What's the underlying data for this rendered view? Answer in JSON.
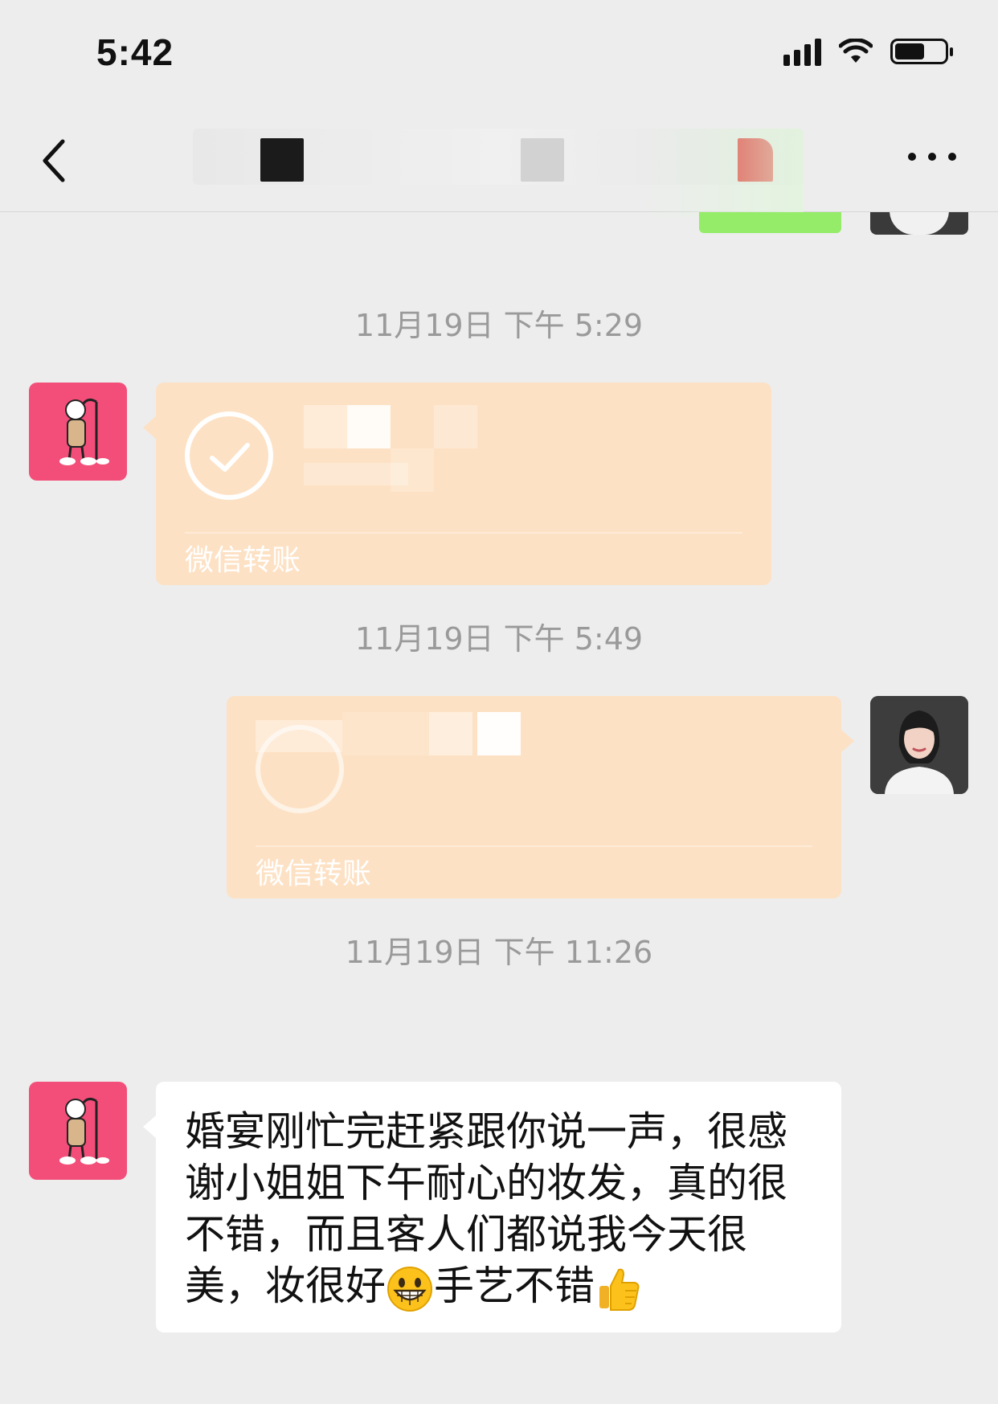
{
  "status_bar": {
    "time": "5:42",
    "battery_level": 0.55,
    "icons": [
      "cellular-signal-icon",
      "wifi-icon",
      "battery-icon"
    ]
  },
  "nav": {
    "back_icon": "chevron-left-icon",
    "more_icon": "ellipsis-icon"
  },
  "messages": [
    {
      "type": "timestamp",
      "text": "11月19日 下午 5:29"
    },
    {
      "type": "transfer",
      "sender": "friend",
      "label": "微信转账",
      "icon": "check-circle-icon"
    },
    {
      "type": "timestamp",
      "text": "11月19日 下午 5:49"
    },
    {
      "type": "transfer",
      "sender": "self",
      "label": "微信转账",
      "icon": "transfer-circle-icon"
    },
    {
      "type": "timestamp",
      "text": "11月19日 下午 11:26"
    },
    {
      "type": "text",
      "sender": "friend",
      "parts": {
        "p1": "婚宴刚忙完赶紧跟你说一声，很感谢小姐姐下午耐心的妆发，真的很不错，而且客人们都说我今天很美，妆很好",
        "p2": "手艺不错"
      },
      "emojis": [
        "grinning-face-emoji",
        "thumbs-up-emoji"
      ]
    }
  ],
  "colors": {
    "background": "#ededed",
    "transfer_bubble": "#fde1c4",
    "self_text_bubble": "#95ec69",
    "friend_avatar": "#f34e79"
  }
}
